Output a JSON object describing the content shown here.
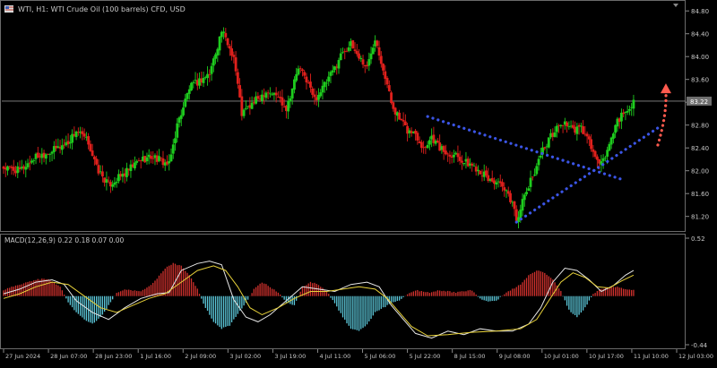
{
  "header": {
    "symbol_label": "WTI, H1:  WTI Crude Oil (100 barrels) CFD, USD",
    "macd_label": "MACD(12,26,9) 0.22 0.18 0.07 0.00"
  },
  "colors": {
    "background": "#000000",
    "bull_candle": "#1ecc1e",
    "bear_candle": "#e0201c",
    "macd_positive": "#d0312d",
    "macd_negative": "#5bc7d9",
    "macd_line": "#e6e6e6",
    "signal_line": "#e8d23a",
    "trendline": "#3b55e6",
    "forecast_arrow": "#ff5a4e",
    "current_price_line": "#8a8a8a"
  },
  "chart_data": [
    {
      "type": "candlestick",
      "panel": "price",
      "y_axis_ticks": [
        "84.80",
        "84.40",
        "84.00",
        "83.60",
        "83.20",
        "82.80",
        "82.40",
        "82.00",
        "81.60",
        "81.20"
      ],
      "ylim": [
        80.96,
        84.96
      ],
      "current_price": "83.22",
      "x_axis_labels": [
        "27 Jun 2024",
        "28 Jun 07:00",
        "28 Jun 23:00",
        "1 Jul 16:00",
        "2 Jul 09:00",
        "3 Jul 02:00",
        "3 Jul 19:00",
        "4 Jul 11:00",
        "5 Jul 06:00",
        "5 Jul 22:00",
        "8 Jul 15:00",
        "9 Jul 08:00",
        "10 Jul 01:00",
        "10 Jul 17:00",
        "11 Jul 10:00",
        "12 Jul 03:00"
      ],
      "close_path": [
        [
          0,
          82.05
        ],
        [
          4,
          82.0
        ],
        [
          8,
          82.25
        ],
        [
          12,
          82.35
        ],
        [
          16,
          82.5
        ],
        [
          18,
          82.7
        ],
        [
          21,
          82.5
        ],
        [
          23,
          82.05
        ],
        [
          26,
          81.75
        ],
        [
          30,
          81.95
        ],
        [
          34,
          82.2
        ],
        [
          37,
          82.25
        ],
        [
          41,
          82.1
        ],
        [
          43,
          82.8
        ],
        [
          46,
          83.45
        ],
        [
          49,
          83.6
        ],
        [
          51,
          83.7
        ],
        [
          54,
          84.45
        ],
        [
          57,
          84.0
        ],
        [
          59,
          83.0
        ],
        [
          62,
          83.2
        ],
        [
          65,
          83.4
        ],
        [
          68,
          83.3
        ],
        [
          70,
          83.1
        ],
        [
          73,
          83.8
        ],
        [
          75,
          83.6
        ],
        [
          77,
          83.25
        ],
        [
          80,
          83.55
        ],
        [
          82,
          83.8
        ],
        [
          84,
          84.1
        ],
        [
          86,
          84.2
        ],
        [
          88,
          84.0
        ],
        [
          90,
          83.8
        ],
        [
          92,
          84.35
        ],
        [
          94,
          83.8
        ],
        [
          96,
          83.2
        ],
        [
          98,
          82.9
        ],
        [
          100,
          82.7
        ],
        [
          102,
          82.65
        ],
        [
          104,
          82.4
        ],
        [
          106,
          82.6
        ],
        [
          108,
          82.4
        ],
        [
          110,
          82.3
        ],
        [
          112,
          82.3
        ],
        [
          114,
          82.15
        ],
        [
          116,
          82.1
        ],
        [
          118,
          82.0
        ],
        [
          120,
          81.85
        ],
        [
          122,
          81.8
        ],
        [
          124,
          81.65
        ],
        [
          126,
          81.45
        ],
        [
          127,
          81.15
        ],
        [
          129,
          81.55
        ],
        [
          131,
          81.9
        ],
        [
          133,
          82.3
        ],
        [
          135,
          82.55
        ],
        [
          137,
          82.75
        ],
        [
          139,
          82.85
        ],
        [
          141,
          82.7
        ],
        [
          143,
          82.75
        ],
        [
          145,
          82.5
        ],
        [
          147,
          82.15
        ],
        [
          148,
          82.1
        ],
        [
          150,
          82.45
        ],
        [
          152,
          82.9
        ],
        [
          154,
          83.0
        ],
        [
          156,
          83.22
        ]
      ]
    },
    {
      "type": "histogram",
      "panel": "macd",
      "title": "MACD(12,26,9) 0.22 0.18 0.07 0.00",
      "y_axis_ticks": [
        "0.52",
        "-0.44"
      ],
      "ylim": [
        -0.44,
        0.52
      ],
      "series": [
        {
          "name": "MACD",
          "points": [
            [
              0,
              0.02
            ],
            [
              4,
              0.06
            ],
            [
              8,
              0.12
            ],
            [
              12,
              0.14
            ],
            [
              15,
              0.1
            ],
            [
              18,
              -0.04
            ],
            [
              22,
              -0.14
            ],
            [
              26,
              -0.2
            ],
            [
              30,
              -0.1
            ],
            [
              34,
              -0.02
            ],
            [
              38,
              0.02
            ],
            [
              41,
              0.03
            ],
            [
              44,
              0.22
            ],
            [
              48,
              0.28
            ],
            [
              51,
              0.3
            ],
            [
              54,
              0.27
            ],
            [
              57,
              -0.03
            ],
            [
              60,
              -0.18
            ],
            [
              63,
              -0.22
            ],
            [
              66,
              -0.16
            ],
            [
              70,
              -0.04
            ],
            [
              74,
              0.08
            ],
            [
              78,
              0.06
            ],
            [
              82,
              0.04
            ],
            [
              86,
              0.1
            ],
            [
              90,
              0.12
            ],
            [
              93,
              0.08
            ],
            [
              96,
              -0.08
            ],
            [
              99,
              -0.2
            ],
            [
              102,
              -0.32
            ],
            [
              106,
              -0.36
            ],
            [
              110,
              -0.3
            ],
            [
              114,
              -0.33
            ],
            [
              118,
              -0.28
            ],
            [
              122,
              -0.3
            ],
            [
              126,
              -0.3
            ],
            [
              130,
              -0.24
            ],
            [
              133,
              -0.1
            ],
            [
              136,
              0.12
            ],
            [
              139,
              0.24
            ],
            [
              142,
              0.22
            ],
            [
              145,
              0.14
            ],
            [
              148,
              0.04
            ],
            [
              151,
              0.09
            ],
            [
              154,
              0.18
            ],
            [
              156,
              0.22
            ]
          ]
        },
        {
          "name": "Signal",
          "points": [
            [
              0,
              -0.02
            ],
            [
              4,
              0.02
            ],
            [
              8,
              0.08
            ],
            [
              12,
              0.12
            ],
            [
              16,
              0.1
            ],
            [
              20,
              0.0
            ],
            [
              24,
              -0.1
            ],
            [
              28,
              -0.14
            ],
            [
              32,
              -0.08
            ],
            [
              36,
              -0.02
            ],
            [
              40,
              0.02
            ],
            [
              44,
              0.12
            ],
            [
              48,
              0.22
            ],
            [
              52,
              0.26
            ],
            [
              55,
              0.22
            ],
            [
              58,
              0.08
            ],
            [
              61,
              -0.1
            ],
            [
              64,
              -0.16
            ],
            [
              68,
              -0.1
            ],
            [
              72,
              -0.02
            ],
            [
              76,
              0.04
            ],
            [
              80,
              0.04
            ],
            [
              84,
              0.06
            ],
            [
              88,
              0.08
            ],
            [
              92,
              0.06
            ],
            [
              95,
              -0.02
            ],
            [
              98,
              -0.14
            ],
            [
              101,
              -0.26
            ],
            [
              105,
              -0.34
            ],
            [
              110,
              -0.33
            ],
            [
              116,
              -0.31
            ],
            [
              122,
              -0.3
            ],
            [
              128,
              -0.28
            ],
            [
              132,
              -0.2
            ],
            [
              135,
              -0.04
            ],
            [
              138,
              0.12
            ],
            [
              141,
              0.2
            ],
            [
              144,
              0.16
            ],
            [
              147,
              0.08
            ],
            [
              150,
              0.07
            ],
            [
              153,
              0.13
            ],
            [
              156,
              0.18
            ]
          ]
        },
        {
          "name": "Histogram",
          "bars": [
            [
              0,
              0.05
            ],
            [
              2,
              0.08
            ],
            [
              4,
              0.1
            ],
            [
              6,
              0.12
            ],
            [
              8,
              0.14
            ],
            [
              10,
              0.15
            ],
            [
              12,
              0.13
            ],
            [
              14,
              0.08
            ],
            [
              16,
              -0.05
            ],
            [
              18,
              -0.14
            ],
            [
              20,
              -0.2
            ],
            [
              22,
              -0.24
            ],
            [
              24,
              -0.18
            ],
            [
              26,
              -0.08
            ],
            [
              28,
              0.03
            ],
            [
              30,
              0.06
            ],
            [
              32,
              0.05
            ],
            [
              34,
              0.04
            ],
            [
              36,
              0.08
            ],
            [
              38,
              0.15
            ],
            [
              40,
              0.24
            ],
            [
              42,
              0.28
            ],
            [
              44,
              0.26
            ],
            [
              46,
              0.18
            ],
            [
              48,
              0.06
            ],
            [
              50,
              -0.1
            ],
            [
              52,
              -0.22
            ],
            [
              54,
              -0.28
            ],
            [
              56,
              -0.25
            ],
            [
              58,
              -0.15
            ],
            [
              60,
              -0.06
            ],
            [
              62,
              0.06
            ],
            [
              64,
              0.12
            ],
            [
              66,
              0.08
            ],
            [
              68,
              0.03
            ],
            [
              70,
              -0.05
            ],
            [
              72,
              -0.08
            ],
            [
              74,
              0.08
            ],
            [
              76,
              0.12
            ],
            [
              78,
              0.1
            ],
            [
              80,
              0.04
            ],
            [
              82,
              -0.06
            ],
            [
              84,
              -0.18
            ],
            [
              86,
              -0.28
            ],
            [
              88,
              -0.3
            ],
            [
              90,
              -0.24
            ],
            [
              92,
              -0.14
            ],
            [
              94,
              -0.1
            ],
            [
              96,
              -0.06
            ],
            [
              98,
              -0.04
            ],
            [
              100,
              0.02
            ],
            [
              102,
              0.05
            ],
            [
              104,
              0.04
            ],
            [
              106,
              0.03
            ],
            [
              108,
              0.05
            ],
            [
              110,
              0.04
            ],
            [
              112,
              0.03
            ],
            [
              114,
              0.04
            ],
            [
              116,
              0.05
            ],
            [
              118,
              -0.02
            ],
            [
              120,
              -0.05
            ],
            [
              122,
              -0.04
            ],
            [
              124,
              0.02
            ],
            [
              126,
              0.06
            ],
            [
              128,
              0.1
            ],
            [
              130,
              0.18
            ],
            [
              132,
              0.22
            ],
            [
              134,
              0.2
            ],
            [
              136,
              0.14
            ],
            [
              138,
              0.04
            ],
            [
              140,
              -0.12
            ],
            [
              142,
              -0.18
            ],
            [
              144,
              -0.1
            ],
            [
              146,
              0.02
            ],
            [
              148,
              0.06
            ],
            [
              150,
              0.08
            ],
            [
              152,
              0.08
            ],
            [
              154,
              0.06
            ],
            [
              156,
              0.05
            ]
          ]
        }
      ]
    }
  ],
  "annotations": {
    "trendline_lower": {
      "from": [
        127,
        81.1
      ],
      "to": [
        162,
        82.75
      ]
    },
    "trendline_upper": {
      "from": [
        105,
        82.95
      ],
      "to": [
        153,
        81.85
      ]
    },
    "forecast_arrow": {
      "from": [
        162,
        82.45
      ],
      "to": [
        164,
        83.5
      ]
    }
  }
}
